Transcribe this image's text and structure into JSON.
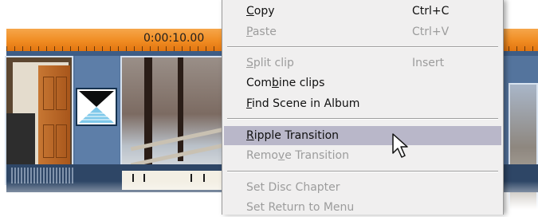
{
  "timeline": {
    "timecode": "0:00:10.00",
    "ruler_color": "#f08c22",
    "track_color": "#3e5d86"
  },
  "context_menu": {
    "highlight_color": "#b9b7c9",
    "items": [
      {
        "label": "Copy",
        "mnemonic": "C",
        "shortcut": "Ctrl+C",
        "enabled": true
      },
      {
        "label": "Paste",
        "mnemonic": "P",
        "shortcut": "Ctrl+V",
        "enabled": false
      },
      {
        "label": "Split clip",
        "mnemonic": "S",
        "shortcut": "Insert",
        "enabled": false
      },
      {
        "label": "Combine clips",
        "mnemonic": "b",
        "shortcut": "",
        "enabled": true
      },
      {
        "label": "Find Scene in Album",
        "mnemonic": "F",
        "shortcut": "",
        "enabled": true
      },
      {
        "label": "Ripple Transition",
        "mnemonic": "R",
        "shortcut": "",
        "enabled": true,
        "highlighted": true
      },
      {
        "label": "Remove Transition",
        "mnemonic": "v",
        "shortcut": "",
        "enabled": false
      },
      {
        "label": "Set Disc Chapter",
        "mnemonic": "",
        "shortcut": "",
        "enabled": false
      },
      {
        "label": "Set Return to Menu",
        "mnemonic": "",
        "shortcut": "",
        "enabled": false
      }
    ]
  },
  "icons": {
    "cursor": "mouse-pointer-icon",
    "transition": "hourglass-transition-icon"
  }
}
